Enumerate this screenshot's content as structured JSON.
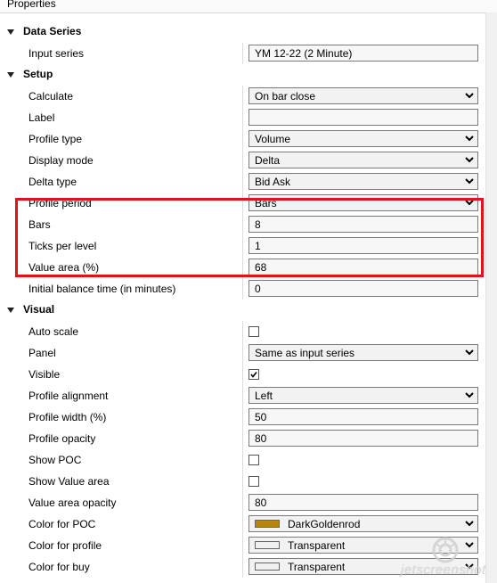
{
  "panel_title": "Properties",
  "sections": [
    {
      "title": "Data Series",
      "props": [
        {
          "label": "Input series",
          "type": "text",
          "value": "YM 12-22 (2 Minute)"
        }
      ]
    },
    {
      "title": "Setup",
      "props": [
        {
          "label": "Calculate",
          "type": "select",
          "value": "On bar close"
        },
        {
          "label": "Label",
          "type": "text",
          "value": ""
        },
        {
          "label": "Profile type",
          "type": "select",
          "value": "Volume"
        },
        {
          "label": "Display mode",
          "type": "select",
          "value": "Delta"
        },
        {
          "label": "Delta type",
          "type": "select",
          "value": "Bid Ask"
        },
        {
          "label": "Profile period",
          "type": "select",
          "value": "Bars"
        },
        {
          "label": "Bars",
          "type": "text",
          "value": "8"
        },
        {
          "label": "Ticks per level",
          "type": "text",
          "value": "1"
        },
        {
          "label": "Value area (%)",
          "type": "text",
          "value": "68"
        },
        {
          "label": "Initial balance time (in minutes)",
          "type": "text",
          "value": "0"
        }
      ]
    },
    {
      "title": "Visual",
      "props": [
        {
          "label": "Auto scale",
          "type": "checkbox",
          "checked": false
        },
        {
          "label": "Panel",
          "type": "select",
          "value": "Same as input series"
        },
        {
          "label": "Visible",
          "type": "checkbox",
          "checked": true
        },
        {
          "label": "Profile alignment",
          "type": "select",
          "value": "Left"
        },
        {
          "label": "Profile width (%)",
          "type": "text",
          "value": "50"
        },
        {
          "label": "Profile opacity",
          "type": "text",
          "value": "80"
        },
        {
          "label": "Show POC",
          "type": "checkbox",
          "checked": false
        },
        {
          "label": "Show Value area",
          "type": "checkbox",
          "checked": false
        },
        {
          "label": "Value area opacity",
          "type": "text",
          "value": "80"
        },
        {
          "label": "Color for POC",
          "type": "color",
          "value": "DarkGoldenrod",
          "color": "#b8860b"
        },
        {
          "label": "Color for profile",
          "type": "color",
          "value": "Transparent",
          "color": "#f0f0f0"
        },
        {
          "label": "Color for buy",
          "type": "color",
          "value": "Transparent",
          "color": "#f0f0f0"
        }
      ]
    }
  ],
  "highlight_color": "#e0121a",
  "watermark": "jetscreenshot"
}
